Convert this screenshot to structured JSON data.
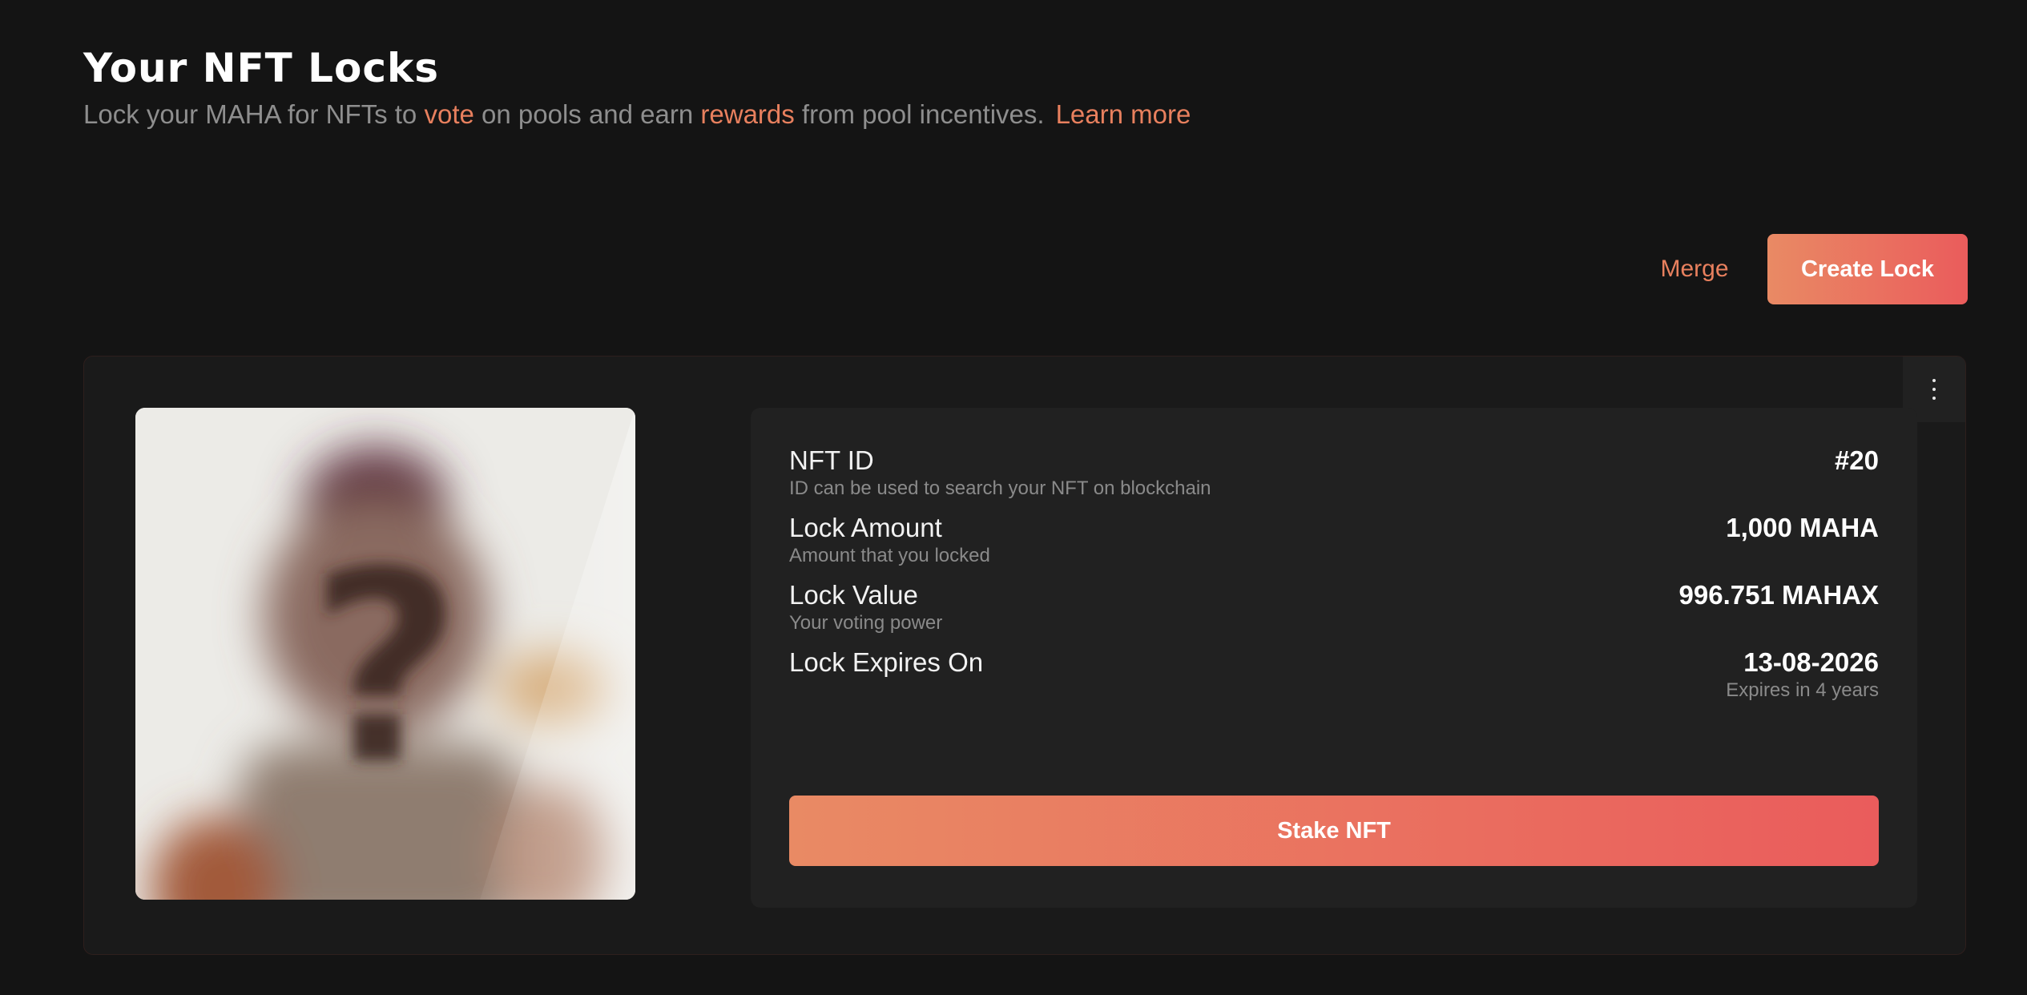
{
  "header": {
    "title": "Your NFT Locks",
    "subtitle_1": "Lock your MAHA for NFTs to ",
    "subtitle_vote": "vote",
    "subtitle_2": " on pools and earn ",
    "subtitle_rewards": "rewards",
    "subtitle_3": " from pool incentives.",
    "learn_more": "Learn more"
  },
  "actions": {
    "merge_label": "Merge",
    "create_lock_label": "Create Lock"
  },
  "lock": {
    "image_glyph": "?",
    "rows": [
      {
        "label": "NFT ID",
        "sublabel": "ID can be used to search your NFT on blockchain",
        "value": "#20",
        "value_sub": ""
      },
      {
        "label": "Lock Amount",
        "sublabel": "Amount that you locked",
        "value": "1,000 MAHA",
        "value_sub": ""
      },
      {
        "label": "Lock Value",
        "sublabel": "Your voting power",
        "value": "996.751 MAHAX",
        "value_sub": ""
      },
      {
        "label": "Lock Expires On",
        "sublabel": "",
        "value": "13-08-2026",
        "value_sub": "Expires in 4 years"
      }
    ],
    "stake_label": "Stake NFT"
  },
  "icons": {
    "menu": "more-vertical-icon"
  },
  "colors": {
    "background": "#141414",
    "card": "#1a1a1a",
    "panel": "#212121",
    "accent": "#e8805e",
    "gradient_start": "#e98a64",
    "gradient_end": "#ea5c5c",
    "muted_text": "#8e8e8e"
  }
}
